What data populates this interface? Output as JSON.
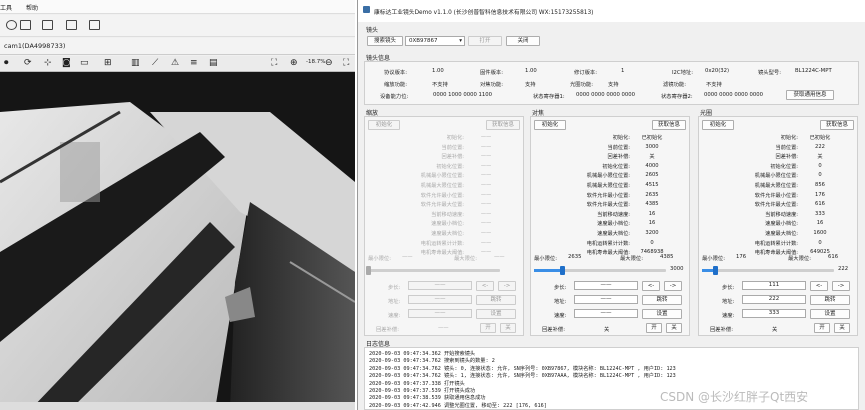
{
  "cam": {
    "menu": [
      "工具",
      "帮助"
    ],
    "tab_title": "cam1(DA4998733)",
    "zoom": "-18.7%"
  },
  "demo": {
    "title": "康标达工业镜头Demo v1.1.0 (长沙创普智科信息技术有限公司 WX:15173255813)",
    "lens_section": "镜头",
    "search_btn": "搜索镜头",
    "lens_select": "0XB97867",
    "open_btn": "打开",
    "close_btn": "关闭",
    "info_section": "镜头信息",
    "info": {
      "proto_ver_label": "协议版本:",
      "proto_ver": "1.00",
      "fw_ver_label": "固件版本:",
      "fw_ver": "1.00",
      "rev_label": "修订版本:",
      "rev": "1",
      "i2c_label": "I2C地址:",
      "i2c": "0x20(32)",
      "model_label": "镜头型号:",
      "model": "BL1224C-MPT",
      "zoom_fn_label": "缩放功能:",
      "zoom_fn": "不支持",
      "focus_fn_label": "对焦功能:",
      "focus_fn": "支持",
      "iris_fn_label": "光圈功能:",
      "iris_fn": "支持",
      "filter_fn_label": "滤镜功能:",
      "filter_fn": "不支持",
      "cap_label": "设备能力位:",
      "cap": "0000 1000 0000 1100",
      "status1_label": "状态寄存器1:",
      "status1": "0000 0000 0000 0000",
      "status2_label": "状态寄存器2:",
      "status2": "0000 0000 0000 0000",
      "get_status_btn": "获取通用信息"
    },
    "row_labels": [
      "初始化:",
      "当前位置:",
      "回差补偿:",
      "初始化位置:",
      "机械最小限位位置:",
      "机械最大限位位置:",
      "软件允许最小位置:",
      "软件允许最大位置:",
      "当前移动速度:",
      "速度最小档位:",
      "速度最大档位:",
      "电机运转累计计数:",
      "电机寿命最大阈值:"
    ],
    "panels": [
      {
        "title": "缩放",
        "init_btn": "初始化",
        "get_btn": "获取信息",
        "values": [
          "——",
          "——",
          "——",
          "——",
          "——",
          "——",
          "——",
          "——",
          "——",
          "——",
          "——",
          "——",
          "——"
        ],
        "min_label": "最小限位:",
        "min": "——",
        "max_label": "最大限位:",
        "max": "——",
        "slider_val": "",
        "step_label": "步长:",
        "step": "——",
        "addr_label": "地址:",
        "addr": "——",
        "jump_btn": "跳转",
        "speed_label": "速度:",
        "speed": "——",
        "set_btn": "设置",
        "backlash_label": "回差补偿:",
        "backlash": "——",
        "on_btn": "开",
        "off_btn": "关",
        "fill": 0.0
      },
      {
        "title": "对焦",
        "init_btn": "初始化",
        "get_btn": "获取信息",
        "values": [
          "已初始化",
          "3000",
          "关",
          "4000",
          "2605",
          "4515",
          "2635",
          "4385",
          "16",
          "16",
          "3200",
          "0",
          "7468938"
        ],
        "min_label": "最小限位:",
        "min": "2635",
        "max_label": "最大限位:",
        "max": "4385",
        "slider_val": "3000",
        "step_label": "步长:",
        "step": "——",
        "addr_label": "地址:",
        "addr": "——",
        "jump_btn": "跳转",
        "speed_label": "速度:",
        "speed": "——",
        "set_btn": "设置",
        "backlash_label": "回差补偿:",
        "backlash": "关",
        "on_btn": "开",
        "off_btn": "关",
        "fill": 0.21
      },
      {
        "title": "光圈",
        "init_btn": "初始化",
        "get_btn": "获取信息",
        "values": [
          "已初始化",
          "222",
          "关",
          "0",
          "0",
          "856",
          "176",
          "616",
          "333",
          "16",
          "1600",
          "0",
          "649025"
        ],
        "min_label": "最小限位:",
        "min": "176",
        "max_label": "最大限位:",
        "max": "616",
        "slider_val": "222",
        "step_label": "步长:",
        "step": "111",
        "addr_label": "地址:",
        "addr": "222",
        "jump_btn": "跳转",
        "speed_label": "速度:",
        "speed": "333",
        "set_btn": "设置",
        "backlash_label": "回差补偿:",
        "backlash": "关",
        "on_btn": "开",
        "off_btn": "关",
        "fill": 0.1
      }
    ],
    "log_section": "日志信息",
    "log": [
      "2020-09-03 09:47:34.362  开始搜索镜头",
      "2020-09-03 09:47:34.762  搜索到镜头的数量: 2",
      "2020-09-03 09:47:34.762  镜头: 0, 连接状态: 允许, SN序列号: 0XB97867, 模块名称: BL1224C-MPT              , 用户ID: 123",
      "2020-09-03 09:47:34.762  镜头: 1, 连接状态: 允许, SN序列号: 0XB97AAA, 模块名称: BL1224C-MPT              , 用户ID: 123",
      "2020-09-03 09:47:37.338  打开镜头",
      "2020-09-03 09:47:37.539  打开镜头成功",
      "2020-09-03 09:47:38.539  获取通用信息成功",
      "2020-09-03 09:47:42.946  调整光圈位置, 移动至: 222 [176, 616]"
    ]
  },
  "watermark": "CSDN @长沙红胖子Qt西安"
}
